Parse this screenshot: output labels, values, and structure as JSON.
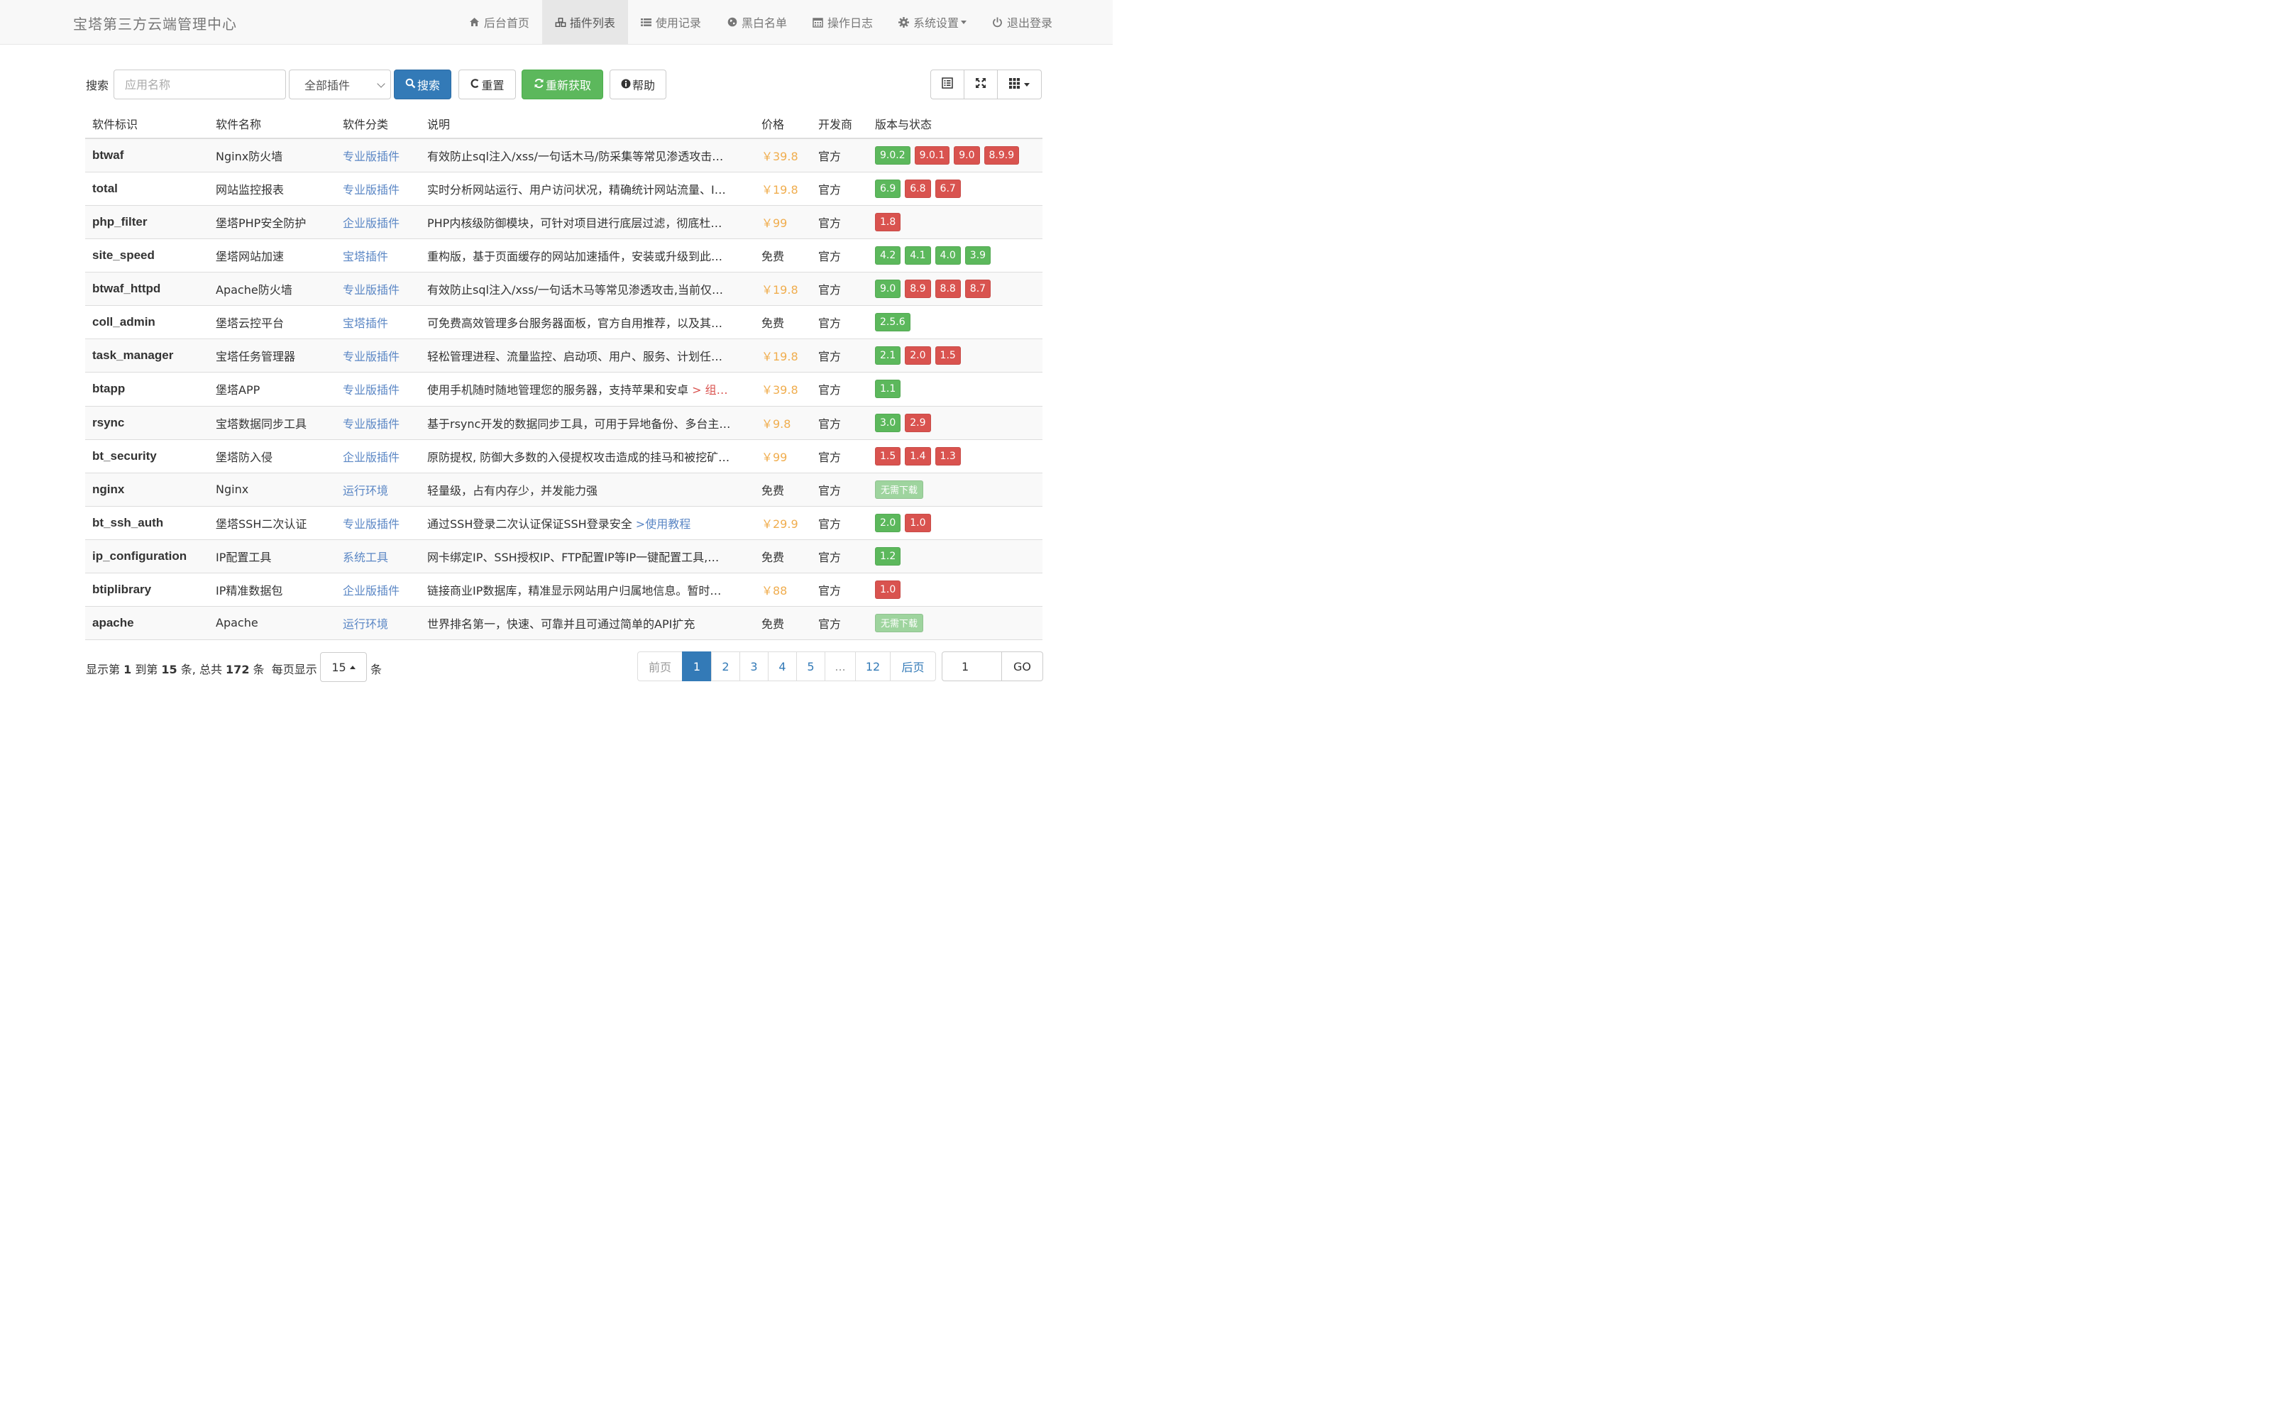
{
  "navbar": {
    "brand": "宝塔第三方云端管理中心",
    "items": [
      {
        "icon": "home-icon",
        "label": "后台首页"
      },
      {
        "icon": "cubes-icon",
        "label": "插件列表",
        "active": true
      },
      {
        "icon": "list-icon",
        "label": "使用记录"
      },
      {
        "icon": "globe-icon",
        "label": "黑白名单"
      },
      {
        "icon": "calendar-icon",
        "label": "操作日志"
      },
      {
        "icon": "gear-icon",
        "label": "系统设置",
        "dropdown": true
      },
      {
        "icon": "power-icon",
        "label": "退出登录"
      }
    ]
  },
  "toolbar": {
    "search_label": "搜索",
    "search_placeholder": "应用名称",
    "category_select": "全部插件",
    "search_button": "搜索",
    "reset_button": "重置",
    "refetch_button": "重新获取",
    "help_button": "帮助"
  },
  "table": {
    "columns": [
      "软件标识",
      "软件名称",
      "软件分类",
      "说明",
      "价格",
      "开发商",
      "版本与状态"
    ],
    "rows": [
      {
        "id": "btwaf",
        "name": "Nginx防火墙",
        "category": "专业版插件",
        "desc": "有效防止sql注入/xss/一句话木马/防采集等常见渗透攻击…",
        "price": "￥39.8",
        "paid": true,
        "dev": "官方",
        "versions": [
          {
            "v": "9.0.2",
            "c": "green"
          },
          {
            "v": "9.0.1",
            "c": "red"
          },
          {
            "v": "9.0",
            "c": "red"
          },
          {
            "v": "8.9.9",
            "c": "red"
          }
        ]
      },
      {
        "id": "total",
        "name": "网站监控报表",
        "category": "专业版插件",
        "desc": "实时分析网站运行、用户访问状况，精确统计网站流量、I…",
        "price": "￥19.8",
        "paid": true,
        "dev": "官方",
        "versions": [
          {
            "v": "6.9",
            "c": "green"
          },
          {
            "v": "6.8",
            "c": "red"
          },
          {
            "v": "6.7",
            "c": "red"
          }
        ]
      },
      {
        "id": "php_filter",
        "name": "堡塔PHP安全防护",
        "category": "企业版插件",
        "desc": "PHP内核级防御模块，可针对项目进行底层过滤，彻底杜…",
        "price": "￥99",
        "paid": true,
        "dev": "官方",
        "versions": [
          {
            "v": "1.8",
            "c": "red"
          }
        ]
      },
      {
        "id": "site_speed",
        "name": "堡塔网站加速",
        "category": "宝塔插件",
        "desc": "重构版，基于页面缓存的网站加速插件，安装或升级到此…",
        "price": "免费",
        "paid": false,
        "dev": "官方",
        "versions": [
          {
            "v": "4.2",
            "c": "green"
          },
          {
            "v": "4.1",
            "c": "green"
          },
          {
            "v": "4.0",
            "c": "green"
          },
          {
            "v": "3.9",
            "c": "green"
          }
        ]
      },
      {
        "id": "btwaf_httpd",
        "name": "Apache防火墙",
        "category": "专业版插件",
        "desc": "有效防止sql注入/xss/一句话木马等常见渗透攻击,当前仅…",
        "price": "￥19.8",
        "paid": true,
        "dev": "官方",
        "versions": [
          {
            "v": "9.0",
            "c": "green"
          },
          {
            "v": "8.9",
            "c": "red"
          },
          {
            "v": "8.8",
            "c": "red"
          },
          {
            "v": "8.7",
            "c": "red"
          }
        ]
      },
      {
        "id": "coll_admin",
        "name": "堡塔云控平台",
        "category": "宝塔插件",
        "desc": "可免费高效管理多台服务器面板，官方自用推荐，以及其…",
        "price": "免费",
        "paid": false,
        "dev": "官方",
        "versions": [
          {
            "v": "2.5.6",
            "c": "green"
          }
        ]
      },
      {
        "id": "task_manager",
        "name": "宝塔任务管理器",
        "category": "专业版插件",
        "desc": "轻松管理进程、流量监控、启动项、用户、服务、计划任…",
        "price": "￥19.8",
        "paid": true,
        "dev": "官方",
        "versions": [
          {
            "v": "2.1",
            "c": "green"
          },
          {
            "v": "2.0",
            "c": "red"
          },
          {
            "v": "1.5",
            "c": "red"
          }
        ]
      },
      {
        "id": "btapp",
        "name": "堡塔APP",
        "category": "专业版插件",
        "desc": "使用手机随时随地管理您的服务器，支持苹果和安卓",
        "desc_extra": " > 组…",
        "price": "￥39.8",
        "paid": true,
        "dev": "官方",
        "versions": [
          {
            "v": "1.1",
            "c": "green"
          }
        ]
      },
      {
        "id": "rsync",
        "name": "宝塔数据同步工具",
        "category": "专业版插件",
        "desc": "基于rsync开发的数据同步工具，可用于异地备份、多台主…",
        "price": "￥9.8",
        "paid": true,
        "dev": "官方",
        "versions": [
          {
            "v": "3.0",
            "c": "green"
          },
          {
            "v": "2.9",
            "c": "red"
          }
        ]
      },
      {
        "id": "bt_security",
        "name": "堡塔防入侵",
        "category": "企业版插件",
        "desc": "原防提权, 防御大多数的入侵提权攻击造成的挂马和被挖矿…",
        "price": "￥99",
        "paid": true,
        "dev": "官方",
        "versions": [
          {
            "v": "1.5",
            "c": "red"
          },
          {
            "v": "1.4",
            "c": "red"
          },
          {
            "v": "1.3",
            "c": "red"
          }
        ]
      },
      {
        "id": "nginx",
        "name": "Nginx",
        "category": "运行环境",
        "desc": "轻量级，占有内存少，并发能力强",
        "price": "免费",
        "paid": false,
        "dev": "官方",
        "versions": [
          {
            "v": "无需下载",
            "c": "light"
          }
        ]
      },
      {
        "id": "bt_ssh_auth",
        "name": "堡塔SSH二次认证",
        "category": "专业版插件",
        "desc": "通过SSH登录二次认证保证SSH登录安全 ",
        "desc_link": ">使用教程",
        "price": "￥29.9",
        "paid": true,
        "dev": "官方",
        "versions": [
          {
            "v": "2.0",
            "c": "green"
          },
          {
            "v": "1.0",
            "c": "red"
          }
        ]
      },
      {
        "id": "ip_configuration",
        "name": "IP配置工具",
        "category": "系统工具",
        "desc": "网卡绑定IP、SSH授权IP、FTP配置IP等IP一键配置工具,…",
        "price": "免费",
        "paid": false,
        "dev": "官方",
        "versions": [
          {
            "v": "1.2",
            "c": "green"
          }
        ]
      },
      {
        "id": "btiplibrary",
        "name": "IP精准数据包",
        "category": "企业版插件",
        "desc": "链接商业IP数据库，精准显示网站用户归属地信息。暂时…",
        "price": "￥88",
        "paid": true,
        "dev": "官方",
        "versions": [
          {
            "v": "1.0",
            "c": "red"
          }
        ]
      },
      {
        "id": "apache",
        "name": "Apache",
        "category": "运行环境",
        "desc": "世界排名第一，快速、可靠并且可通过简单的API扩充",
        "price": "免费",
        "paid": false,
        "dev": "官方",
        "versions": [
          {
            "v": "无需下载",
            "c": "light"
          }
        ]
      }
    ]
  },
  "footer": {
    "info_prefix": "显示第 ",
    "from": "1",
    "info_mid1": " 到第 ",
    "to": "15",
    "info_mid2": " 条, 总共 ",
    "total": "172",
    "info_suffix": " 条",
    "per_page_label": "每页显示",
    "per_page_value": "15",
    "per_page_unit": "条",
    "pager": [
      "前页",
      "1",
      "2",
      "3",
      "4",
      "5",
      "...",
      "12",
      "后页"
    ],
    "current_page": "1",
    "goto_value": "1",
    "goto_button": "GO"
  },
  "colors": {
    "primary": "#337ab7",
    "success": "#5cb85c",
    "danger": "#d9534f",
    "price": "#f0ad4e",
    "link": "#5b87c5"
  }
}
